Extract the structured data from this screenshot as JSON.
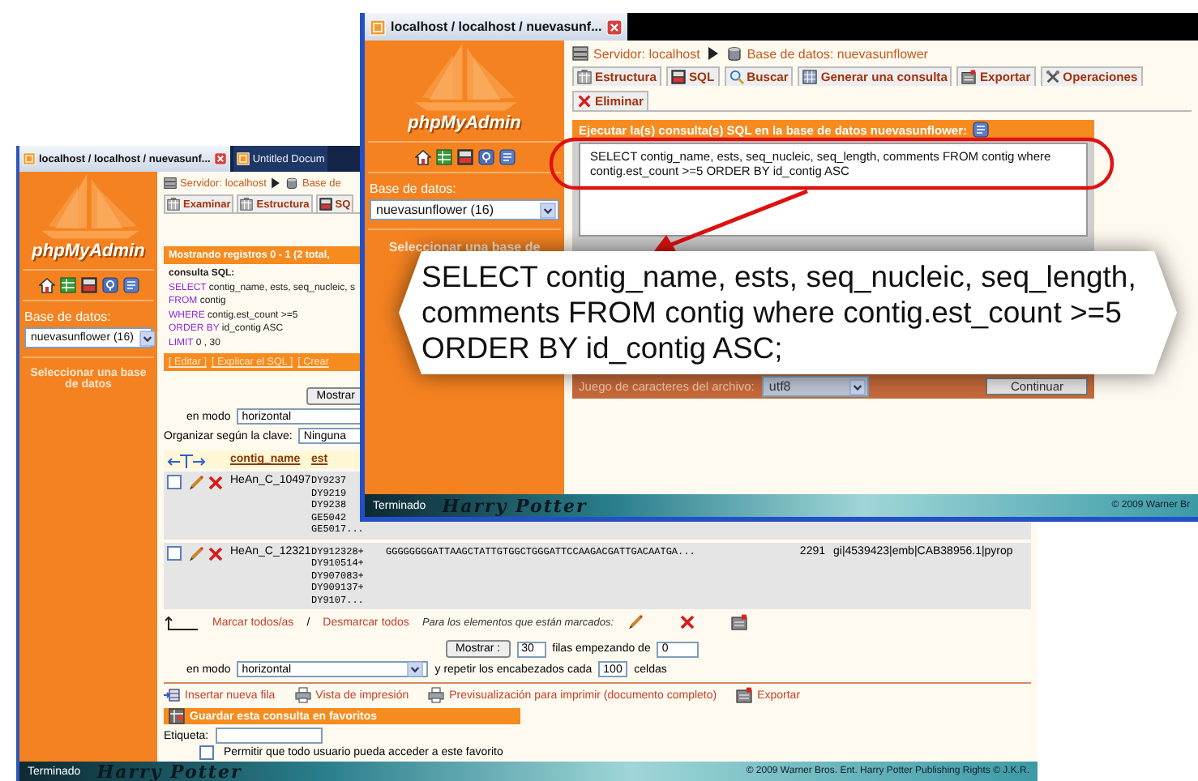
{
  "back_window": {
    "browser_tabs": [
      {
        "title": "localhost / localhost / nuevasunf...",
        "selected": true
      },
      {
        "title": "Untitled Docum",
        "selected": false
      }
    ],
    "sidebar": {
      "logo": "phpMyAdmin",
      "database_label": "Base de datos:",
      "database": "nuevasunflower (16)",
      "hint": "Seleccionar una base de datos"
    },
    "breadcrumb": {
      "server": "Servidor: localhost",
      "database": "Base de"
    },
    "tabs": [
      {
        "label": "Examinar"
      },
      {
        "label": "Estructura"
      },
      {
        "label": "SQ"
      }
    ],
    "result_title": "Mostrando registros 0 - 1 (2 total,",
    "sql": {
      "label": "consulta SQL:",
      "lines": [
        {
          "keyword": "SELECT",
          "text": "contig_name, ests, seq_nucleic, s"
        },
        {
          "keyword": "FROM",
          "text": "contig"
        },
        {
          "keyword": "WHERE",
          "text": "contig.est_count >=5"
        },
        {
          "keyword": "ORDER BY",
          "text": "id_contig ASC"
        },
        {
          "keyword": "LIMIT",
          "text": "0 , 30"
        }
      ]
    },
    "sql_links": [
      "[ Editar ]",
      "[ Explicar el SQL ]",
      "[ Crear"
    ],
    "top_nav": {
      "button": "Mostrar",
      "mode_label": "en modo",
      "mode": "horizontal",
      "sort_label": "Organizar según la clave:",
      "sort": "Ninguna"
    },
    "table": {
      "columns": [
        "contig_name",
        "est"
      ],
      "rows": [
        {
          "checked": false,
          "contig_name": "HeAn_C_10497",
          "ests": [
            "DY9237",
            "DY9219",
            "DY9238",
            "GE5042",
            "GE5017..."
          ]
        },
        {
          "checked": false,
          "contig_name": "HeAn_C_12321",
          "ests": [
            "DY912328+",
            "DY910514+",
            "DY907083+",
            "DY909137+",
            "DY9107..."
          ],
          "seq_nucleic": "GGGGGGGGATTAAGCTATTGTGGCTGGGATTCCAAGACGATTGACAATGA...",
          "seq_length": "2291",
          "comments": "gi|4539423|emb|CAB38956.1|pyrop"
        }
      ]
    },
    "marking": {
      "check_all": "Marcar todos/as",
      "separator": "/",
      "uncheck_all": "Desmarcar todos",
      "with_selected": "Para los elementos que están marcados:"
    },
    "bottom_nav": {
      "button": "Mostrar :",
      "rows": "30",
      "start_label": "filas empezando de",
      "start": "0",
      "mode_label": "en modo",
      "mode": "horizontal",
      "repeat_label": "y repetir los encabezados cada",
      "repeat": "100",
      "cells_label": "celdas"
    },
    "actions": [
      "Insertar nueva fila",
      "Vista de impresión",
      "Previsualización para imprimir (documento completo)",
      "Exportar"
    ],
    "bookmark": {
      "title": "Guardar esta consulta en favoritos",
      "label_field": "Etiqueta:",
      "public_label": "Permitir que todo usuario pueda acceder a este favorito",
      "public": false
    },
    "status_bar": {
      "status": "Terminado",
      "logo": "Harry Potter",
      "copyright": "© 2009 Warner Bros. Ent. Harry Potter Publishing Rights © J.K.R."
    }
  },
  "front_window": {
    "browser_tab": {
      "title": "localhost / localhost / nuevasunf..."
    },
    "sidebar": {
      "logo": "phpMyAdmin",
      "database_label": "Base de datos:",
      "database": "nuevasunflower (16)",
      "hint": "Seleccionar una base de"
    },
    "breadcrumb": {
      "server": "Servidor: localhost",
      "database": "Base de datos: nuevasunflower"
    },
    "tabs": [
      {
        "label": "Estructura"
      },
      {
        "label": "SQL"
      },
      {
        "label": "Buscar"
      },
      {
        "label": "Generar una consulta"
      },
      {
        "label": "Exportar"
      },
      {
        "label": "Operaciones"
      },
      {
        "label": "Eliminar"
      }
    ],
    "query_panel": {
      "title": "Ejecutar la(s) consulta(s) SQL en la base de datos nuevasunflower:",
      "query": "SELECT contig_name, ests, seq_nucleic, seq_length, comments FROM contig where contig.est_count >=5 ORDER BY id_contig ASC",
      "charset_label": "Juego de caracteres del archivo:",
      "charset": "utf8",
      "submit": "Continuar"
    },
    "status_bar": {
      "status": "Terminado",
      "logo": "Harry Potter",
      "copyright": "© 2009 Warner Br"
    }
  },
  "callout": {
    "text": "SELECT contig_name, ests, seq_nucleic, seq_length,\ncomments FROM contig where contig.est_count >=5\nORDER BY id_contig ASC;"
  }
}
